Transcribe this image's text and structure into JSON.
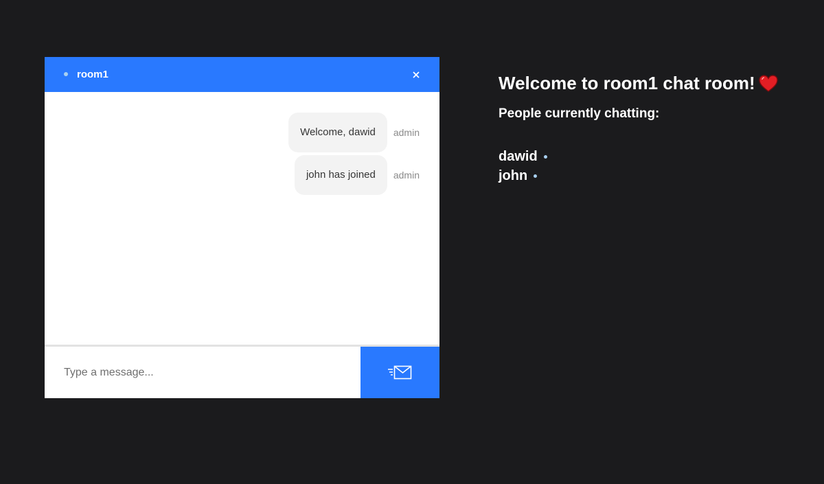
{
  "chat": {
    "room_name": "room1",
    "close_icon": "close-icon",
    "messages": [
      {
        "text": "Welcome, dawid",
        "sender": "admin"
      },
      {
        "text": "john has joined",
        "sender": "admin"
      }
    ],
    "input_placeholder": "Type a message...",
    "input_value": "",
    "send_icon": "envelope-send-icon"
  },
  "info": {
    "welcome_title": "Welcome to room1 chat room!",
    "heart_icon": "heart-icon",
    "people_heading": "People currently chatting:",
    "people": [
      "dawid",
      "john"
    ]
  },
  "colors": {
    "accent": "#2979ff",
    "background": "#1b1b1d",
    "online_dot": "#a8d0f0",
    "heart": "#e31e24"
  }
}
